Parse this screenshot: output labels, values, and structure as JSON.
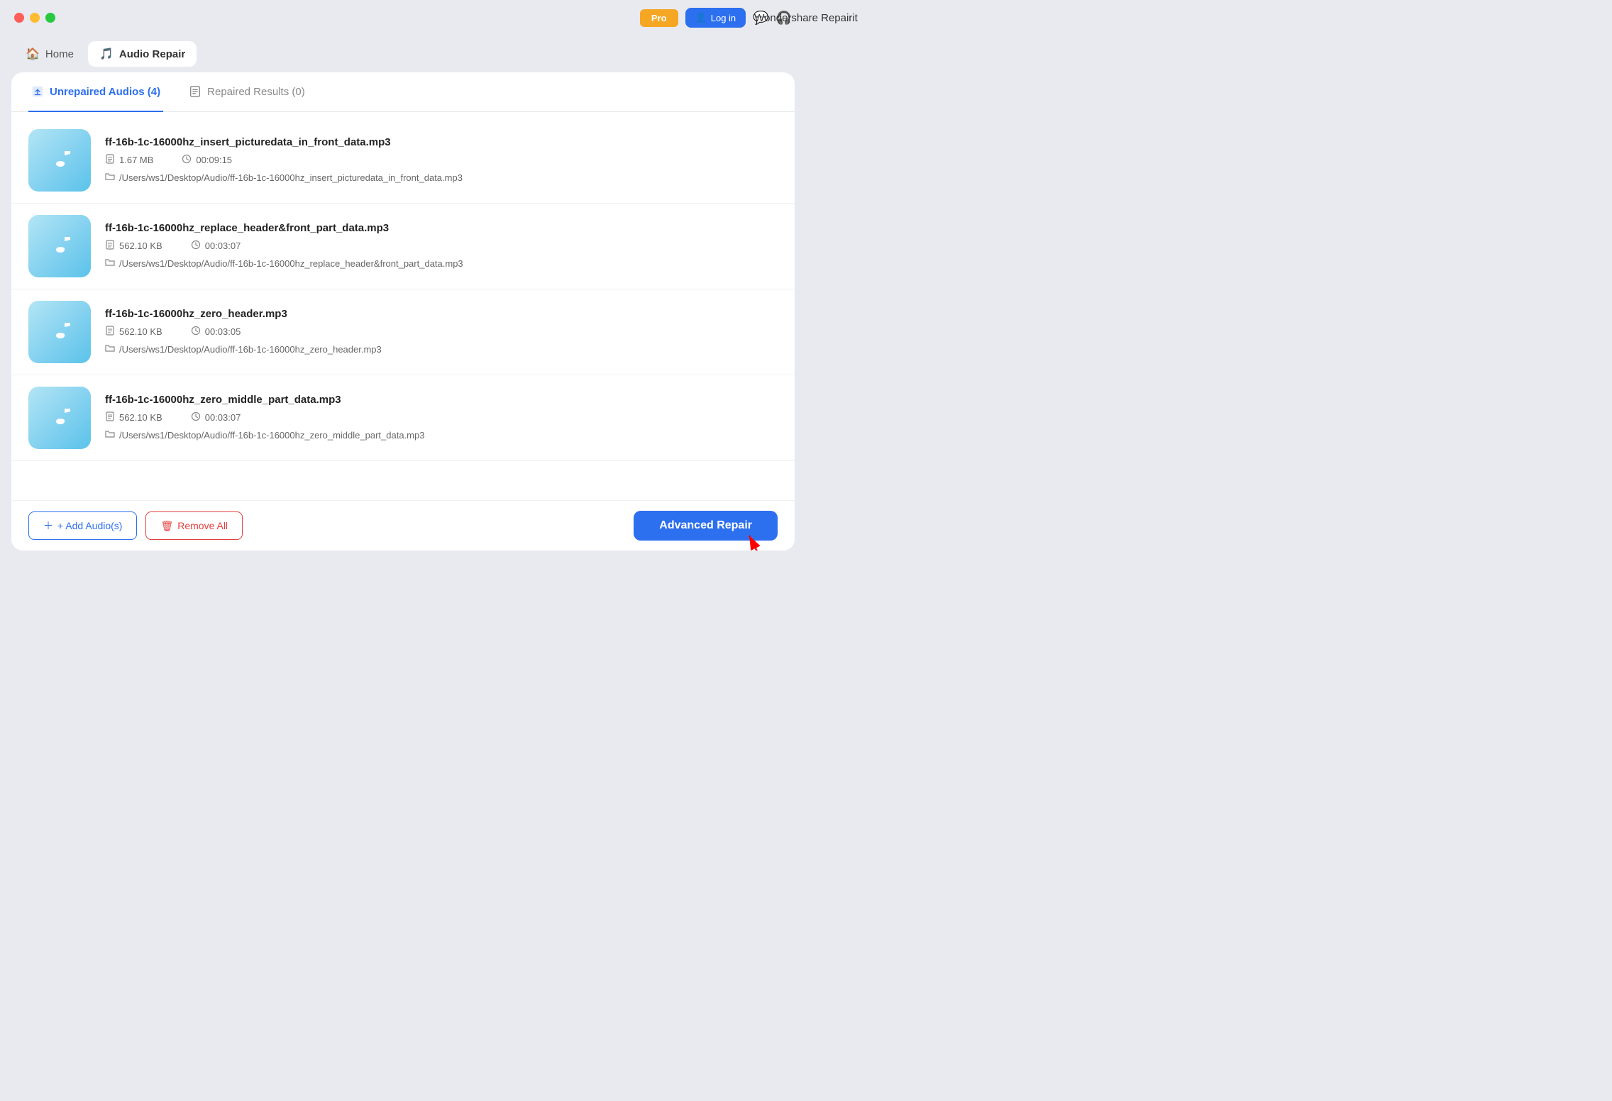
{
  "titleBar": {
    "title": "Wondershare Repairit",
    "proBadge": "Pro",
    "loginBtn": "Log in",
    "chatIcon": "💬",
    "headphonesIcon": "🎧"
  },
  "nav": {
    "homeLabel": "Home",
    "audioRepairLabel": "Audio Repair"
  },
  "tabs": [
    {
      "id": "unrepaired",
      "label": "Unrepaired Audios (4)",
      "active": true
    },
    {
      "id": "repaired",
      "label": "Repaired Results (0)",
      "active": false
    }
  ],
  "files": [
    {
      "name": "ff-16b-1c-16000hz_insert_picturedata_in_front_data.mp3",
      "size": "1.67 MB",
      "duration": "00:09:15",
      "path": "/Users/ws1/Desktop/Audio/ff-16b-1c-16000hz_insert_picturedata_in_front_data.mp3"
    },
    {
      "name": "ff-16b-1c-16000hz_replace_header&front_part_data.mp3",
      "size": "562.10 KB",
      "duration": "00:03:07",
      "path": "/Users/ws1/Desktop/Audio/ff-16b-1c-16000hz_replace_header&front_part_data.mp3"
    },
    {
      "name": "ff-16b-1c-16000hz_zero_header.mp3",
      "size": "562.10 KB",
      "duration": "00:03:05",
      "path": "/Users/ws1/Desktop/Audio/ff-16b-1c-16000hz_zero_header.mp3"
    },
    {
      "name": "ff-16b-1c-16000hz_zero_middle_part_data.mp3",
      "size": "562.10 KB",
      "duration": "00:03:07",
      "path": "/Users/ws1/Desktop/Audio/ff-16b-1c-16000hz_zero_middle_part_data.mp3"
    }
  ],
  "bottomBar": {
    "addLabel": "+ Add Audio(s)",
    "removeLabel": "Remove All",
    "advancedRepairLabel": "Advanced Repair"
  }
}
